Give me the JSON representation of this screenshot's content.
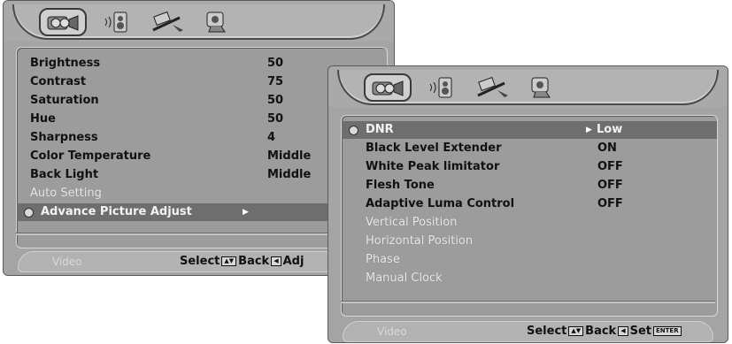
{
  "left_osd": {
    "tabs": [
      "video-settings-icon",
      "audio-settings-icon",
      "setup-icon",
      "other-settings-icon"
    ],
    "items": [
      {
        "label": "Brightness",
        "value": "50"
      },
      {
        "label": "Contrast",
        "value": "75"
      },
      {
        "label": "Saturation",
        "value": "50"
      },
      {
        "label": "Hue",
        "value": "50"
      },
      {
        "label": "Sharpness",
        "value": "4"
      },
      {
        "label": "Color Temperature",
        "value": "Middle"
      },
      {
        "label": "Back Light",
        "value": "Middle"
      },
      {
        "label": "Auto Setting",
        "value": ""
      },
      {
        "label": "Advance Picture Adjust",
        "value": ""
      }
    ],
    "status": {
      "mode": "Video",
      "help": "Select",
      "back": "Back",
      "adj": "Adj"
    }
  },
  "right_osd": {
    "tabs": [
      "video-settings-icon",
      "audio-settings-icon",
      "setup-icon",
      "other-settings-icon"
    ],
    "items": [
      {
        "label": "DNR",
        "value": "Low"
      },
      {
        "label": "Black Level Extender",
        "value": "ON"
      },
      {
        "label": "White Peak limitator",
        "value": "OFF"
      },
      {
        "label": "Flesh Tone",
        "value": "OFF"
      },
      {
        "label": "Adaptive Luma Control",
        "value": "OFF"
      },
      {
        "label": "Vertical Position",
        "value": ""
      },
      {
        "label": "Horizontal Position",
        "value": ""
      },
      {
        "label": "Phase",
        "value": ""
      },
      {
        "label": "Manual Clock",
        "value": ""
      }
    ],
    "status": {
      "mode": "Video",
      "help": "Select",
      "back": "Back",
      "set": "Set",
      "enter_key": "ENTER"
    }
  }
}
